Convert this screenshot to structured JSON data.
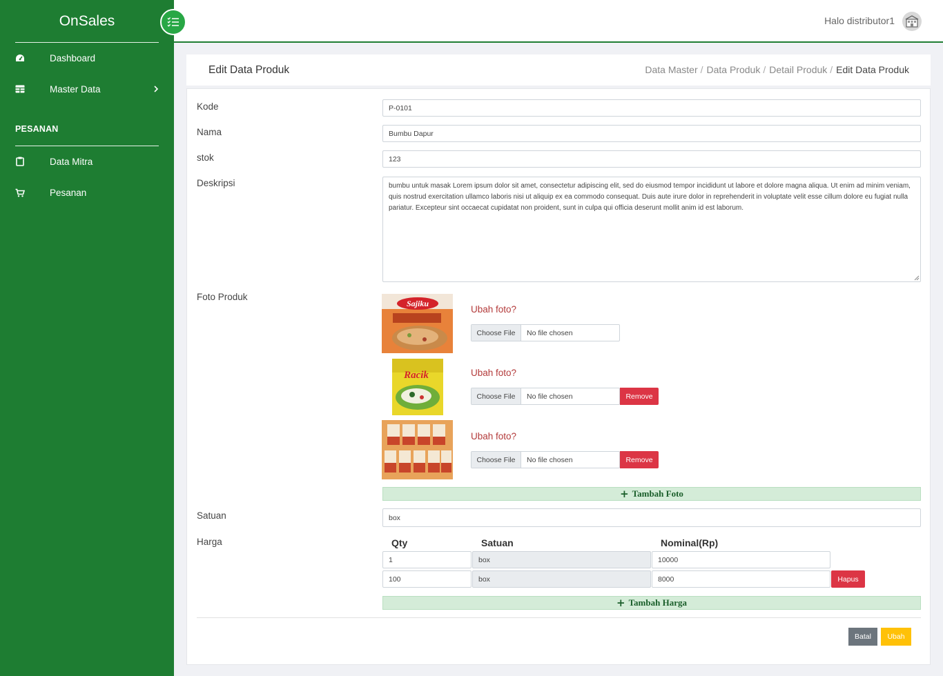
{
  "app": {
    "brand": "OnSales"
  },
  "sidebar": {
    "items": [
      {
        "label": "Dashboard",
        "icon": "dashboard-icon"
      },
      {
        "label": "Master Data",
        "icon": "table-icon"
      }
    ],
    "section_title": "PESANAN",
    "section_items": [
      {
        "label": "Data Mitra",
        "icon": "clipboard-icon"
      },
      {
        "label": "Pesanan",
        "icon": "cart-icon"
      }
    ]
  },
  "topbar": {
    "greeting": "Halo distributor1"
  },
  "header": {
    "title": "Edit Data Produk",
    "breadcrumb": [
      "Data Master",
      "Data Produk",
      "Detail Produk",
      "Edit Data Produk"
    ]
  },
  "form": {
    "kode": {
      "label": "Kode",
      "value": "P-0101"
    },
    "nama": {
      "label": "Nama",
      "value": "Bumbu Dapur"
    },
    "stok": {
      "label": "stok",
      "value": "123"
    },
    "deskripsi": {
      "label": "Deskripsi",
      "value": "bumbu untuk masak Lorem ipsum dolor sit amet, consectetur adipiscing elit, sed do eiusmod tempor incididunt ut labore et dolore magna aliqua. Ut enim ad minim veniam, quis nostrud exercitation ullamco laboris nisi ut aliquip ex ea commodo consequat. Duis aute irure dolor in reprehenderit in voluptate velit esse cillum dolore eu fugiat nulla pariatur. Excepteur sint occaecat cupidatat non proident, sunt in culpa qui officia deserunt mollit anim id est laborum."
    },
    "foto": {
      "label": "Foto Produk",
      "change_label": "Ubah foto?",
      "choose_label": "Choose File",
      "no_file_label": "No file chosen",
      "remove_label": "Remove",
      "add_label": "Tambah Foto",
      "photo_brands": [
        "Sajiku",
        "Racik",
        ""
      ]
    },
    "satuan": {
      "label": "Satuan",
      "value": "box"
    },
    "harga": {
      "label": "Harga",
      "headers": {
        "qty": "Qty",
        "satuan": "Satuan",
        "nominal": "Nominal(Rp)"
      },
      "rows": [
        {
          "qty": "1",
          "satuan": "box",
          "nominal": "10000"
        },
        {
          "qty": "100",
          "satuan": "box",
          "nominal": "8000"
        }
      ],
      "delete_label": "Hapus",
      "add_label": "Tambah Harga"
    },
    "actions": {
      "cancel": "Batal",
      "submit": "Ubah"
    }
  },
  "colors": {
    "sidebar": "#1e7d32",
    "danger": "#dc3545",
    "warning": "#ffc107",
    "secondary": "#6c757d",
    "add_button_bg": "#d4ecd8"
  }
}
